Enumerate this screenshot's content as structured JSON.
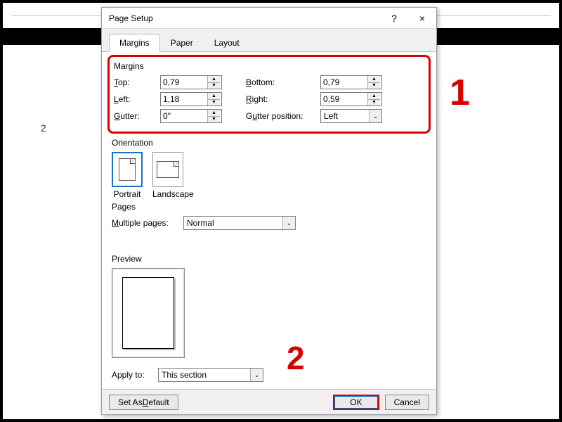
{
  "background": {
    "page_number": "2"
  },
  "dialog": {
    "title": "Page Setup",
    "help": "?",
    "close": "×",
    "tabs": {
      "margins": "Margins",
      "paper": "Paper",
      "layout": "Layout"
    },
    "margins": {
      "group": "Margins",
      "top_label": "Top:",
      "top_value": "0,79",
      "bottom_label": "Bottom:",
      "bottom_value": "0,79",
      "left_label": "Left:",
      "left_value": "1,18",
      "right_label": "Right:",
      "right_value": "0,59",
      "gutter_label": "Gutter:",
      "gutter_value": "0\"",
      "gutter_pos_label": "Gutter position:",
      "gutter_pos_value": "Left"
    },
    "orientation": {
      "group": "Orientation",
      "portrait": "Portrait",
      "landscape": "Landscape"
    },
    "pages": {
      "group": "Pages",
      "multiple_label": "Multiple pages:",
      "multiple_value": "Normal"
    },
    "preview": {
      "group": "Preview"
    },
    "apply": {
      "label": "Apply to:",
      "value": "This section"
    },
    "buttons": {
      "default": "Set As Default",
      "ok": "OK",
      "cancel": "Cancel"
    }
  },
  "annotations": {
    "one": "1",
    "two": "2"
  }
}
